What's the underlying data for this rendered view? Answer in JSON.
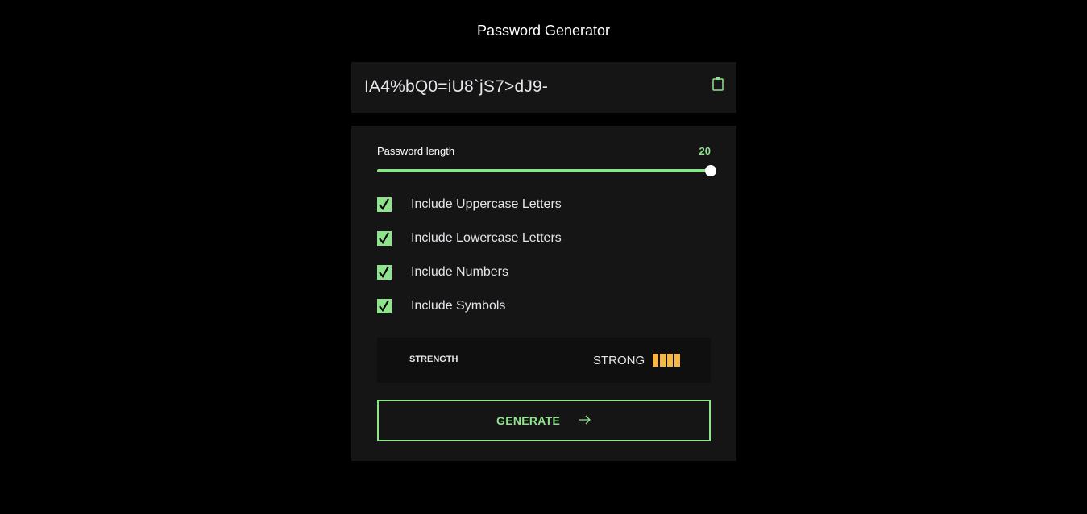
{
  "app": {
    "title": "Password Generator"
  },
  "password": {
    "value": "IA4%bQ0=iU8`jS7>dJ9-",
    "copy_icon": "clipboard-icon"
  },
  "length": {
    "label": "Password length",
    "value": "20",
    "fraction": 1.0
  },
  "options": [
    {
      "label": "Include Uppercase Letters",
      "checked": true
    },
    {
      "label": "Include Lowercase Letters",
      "checked": true
    },
    {
      "label": "Include Numbers",
      "checked": true
    },
    {
      "label": "Include Symbols",
      "checked": true
    }
  ],
  "strength": {
    "label": "STRENGTH",
    "value": "STRONG",
    "level": 4,
    "max": 4
  },
  "generate": {
    "label": "GENERATE",
    "icon": "arrow-right-icon"
  },
  "colors": {
    "accent": "#8fe38c",
    "strength": "#f6b547",
    "panel": "#151515",
    "background": "#000000"
  }
}
